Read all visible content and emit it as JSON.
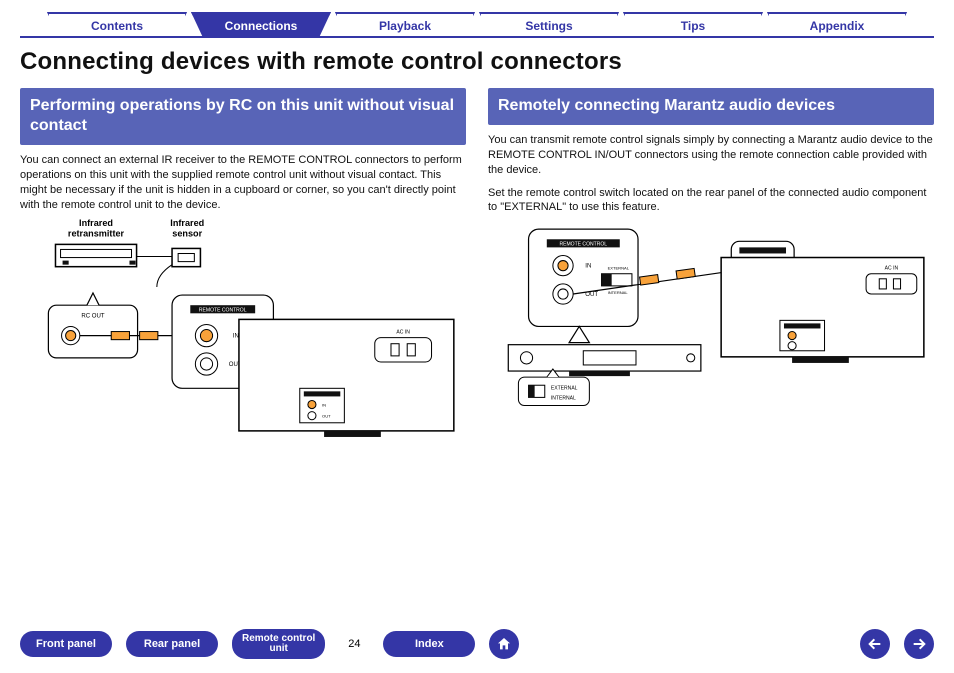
{
  "tabs": [
    {
      "label": "Contents",
      "active": false
    },
    {
      "label": "Connections",
      "active": true
    },
    {
      "label": "Playback",
      "active": false
    },
    {
      "label": "Settings",
      "active": false
    },
    {
      "label": "Tips",
      "active": false
    },
    {
      "label": "Appendix",
      "active": false
    }
  ],
  "page_title": "Connecting devices with remote control connectors",
  "left": {
    "heading": "Performing operations by RC on this unit without visual contact",
    "paragraph": "You can connect an external IR receiver to the REMOTE CONTROL connectors to perform operations on this unit with the supplied remote control unit without visual contact. This might be necessary if the unit is hidden in a cupboard or corner, so you can't directly point with the remote control unit to the device.",
    "diagram_labels": {
      "retransmitter": "Infrared\nretransmitter",
      "sensor": "Infrared\nsensor",
      "rc_out": "RC OUT",
      "remote_control": "REMOTE CONTROL",
      "in": "IN",
      "out": "OUT",
      "ac_in": "AC IN"
    }
  },
  "right": {
    "heading": "Remotely connecting Marantz audio devices",
    "paragraph1": "You can transmit remote control signals simply by connecting a Marantz audio device to the REMOTE CONTROL IN/OUT connectors using the remote connection cable provided with the device.",
    "paragraph2": "Set the remote control switch located on the rear panel of the connected audio component to \"EXTERNAL\" to use this feature.",
    "diagram_labels": {
      "remote_control": "REMOTE CONTROL",
      "in": "IN",
      "out": "OUT",
      "external": "EXTERNAL",
      "internal": "INTERNAL",
      "ac_in": "AC IN"
    }
  },
  "footer": {
    "front_panel": "Front panel",
    "rear_panel": "Rear panel",
    "remote_control_unit": "Remote control\nunit",
    "index": "Index",
    "page_number": "24"
  },
  "icons": {
    "home": "home-icon",
    "prev": "arrow-left-icon",
    "next": "arrow-right-icon"
  },
  "colors": {
    "brand_blue": "#3436a6",
    "section_blue": "#5864b7"
  }
}
